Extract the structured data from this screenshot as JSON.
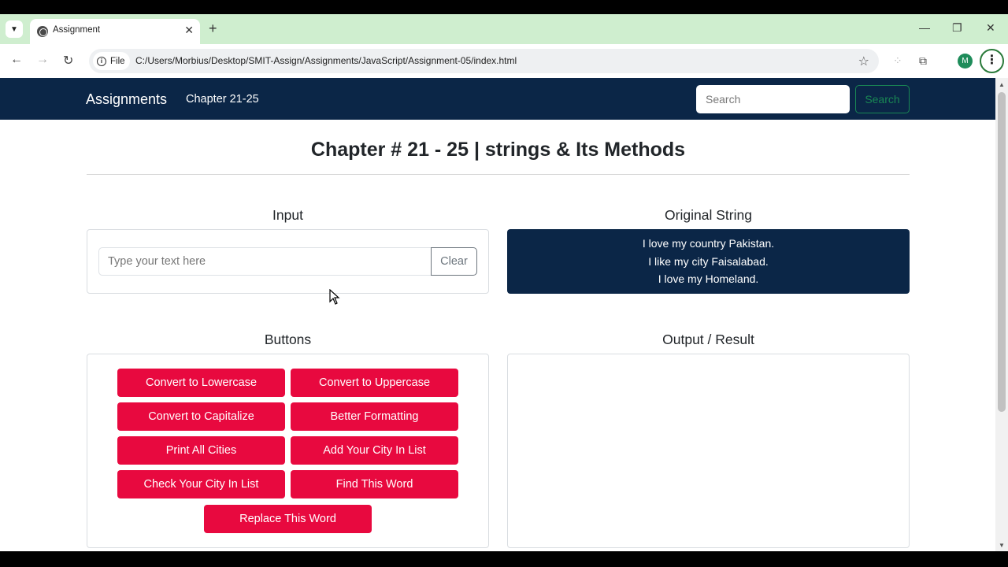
{
  "browser": {
    "tab_title": "Assignment",
    "file_chip": "File",
    "url": "C:/Users/Morbius/Desktop/SMIT-Assign/Assignments/JavaScript/Assignment-05/index.html",
    "profile_initial": "M"
  },
  "navbar": {
    "brand": "Assignments",
    "link": "Chapter 21-25",
    "search_placeholder": "Search",
    "search_button": "Search",
    "bg_color": "#0b2647"
  },
  "page": {
    "heading": "Chapter # 21 - 25 | strings & Its Methods"
  },
  "input_section": {
    "title": "Input",
    "placeholder": "Type your text here",
    "value": "",
    "clear_label": "Clear"
  },
  "original_section": {
    "title": "Original String",
    "lines": [
      "I love my country Pakistan.",
      "I like my city Faisalabad.",
      "I love my Homeland."
    ]
  },
  "buttons_section": {
    "title": "Buttons",
    "accent_color": "#e8093f",
    "buttons": [
      "Convert to Lowercase",
      "Convert to Uppercase",
      "Convert to Capitalize",
      "Better Formatting",
      "Print All Cities",
      "Add Your City In List",
      "Check Your City In List",
      "Find This Word",
      "Replace This Word"
    ]
  },
  "output_section": {
    "title": "Output / Result",
    "content": ""
  }
}
